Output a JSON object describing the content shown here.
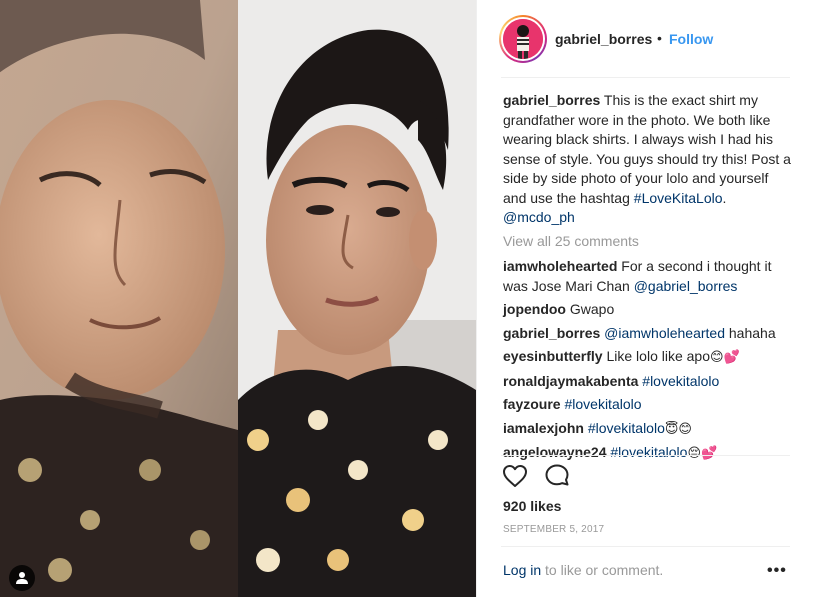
{
  "header": {
    "username": "gabriel_borres",
    "dot": "•",
    "follow_label": "Follow"
  },
  "caption": {
    "username": "gabriel_borres",
    "text": "This is the exact shirt my grandfather wore in the photo. We both like wearing black shirts. I always wish I had his sense of style. You guys should try this! Post a side by side photo of your lolo and yourself and use the hashtag ",
    "hashtag": "#LoveKitaLolo",
    "after_hashtag": ".",
    "mention": "@mcdo_ph"
  },
  "view_all_label": "View all 25 comments",
  "comments": [
    {
      "user": "iamwholehearted",
      "text": "For a second i thought it was Jose Mari Chan ",
      "tag": "@gabriel_borres",
      "emoji": ""
    },
    {
      "user": "jopendoo",
      "text": "Gwapo",
      "tag": "",
      "emoji": ""
    },
    {
      "user": "gabriel_borres",
      "text": "",
      "tag": "@iamwholehearted",
      "after": " hahaha",
      "emoji": ""
    },
    {
      "user": "eyesinbutterfly",
      "text": "Like lolo like apo",
      "tag": "",
      "emoji": "😊💕"
    },
    {
      "user": "ronaldjaymakabenta",
      "text": "",
      "tag": "#lovekitalolo",
      "emoji": ""
    },
    {
      "user": "fayzoure",
      "text": "",
      "tag": "#lovekitalolo",
      "emoji": ""
    },
    {
      "user": "iamalexjohn",
      "text": "",
      "tag": "#lovekitalolo",
      "emoji": "😇😊"
    },
    {
      "user": "angelowayne24",
      "text": "",
      "tag": "#lovekitalolo",
      "emoji": "😔💕"
    }
  ],
  "actions": {
    "like_icon": "heart-icon",
    "comment_icon": "comment-icon"
  },
  "likes": "920 likes",
  "date": "SEPTEMBER 5, 2017",
  "footer": {
    "login": "Log in",
    "rest": " to like or comment.",
    "more": "•••"
  },
  "colors": {
    "link_blue": "#3897f0",
    "tag_blue": "#003569",
    "muted": "#999999"
  }
}
